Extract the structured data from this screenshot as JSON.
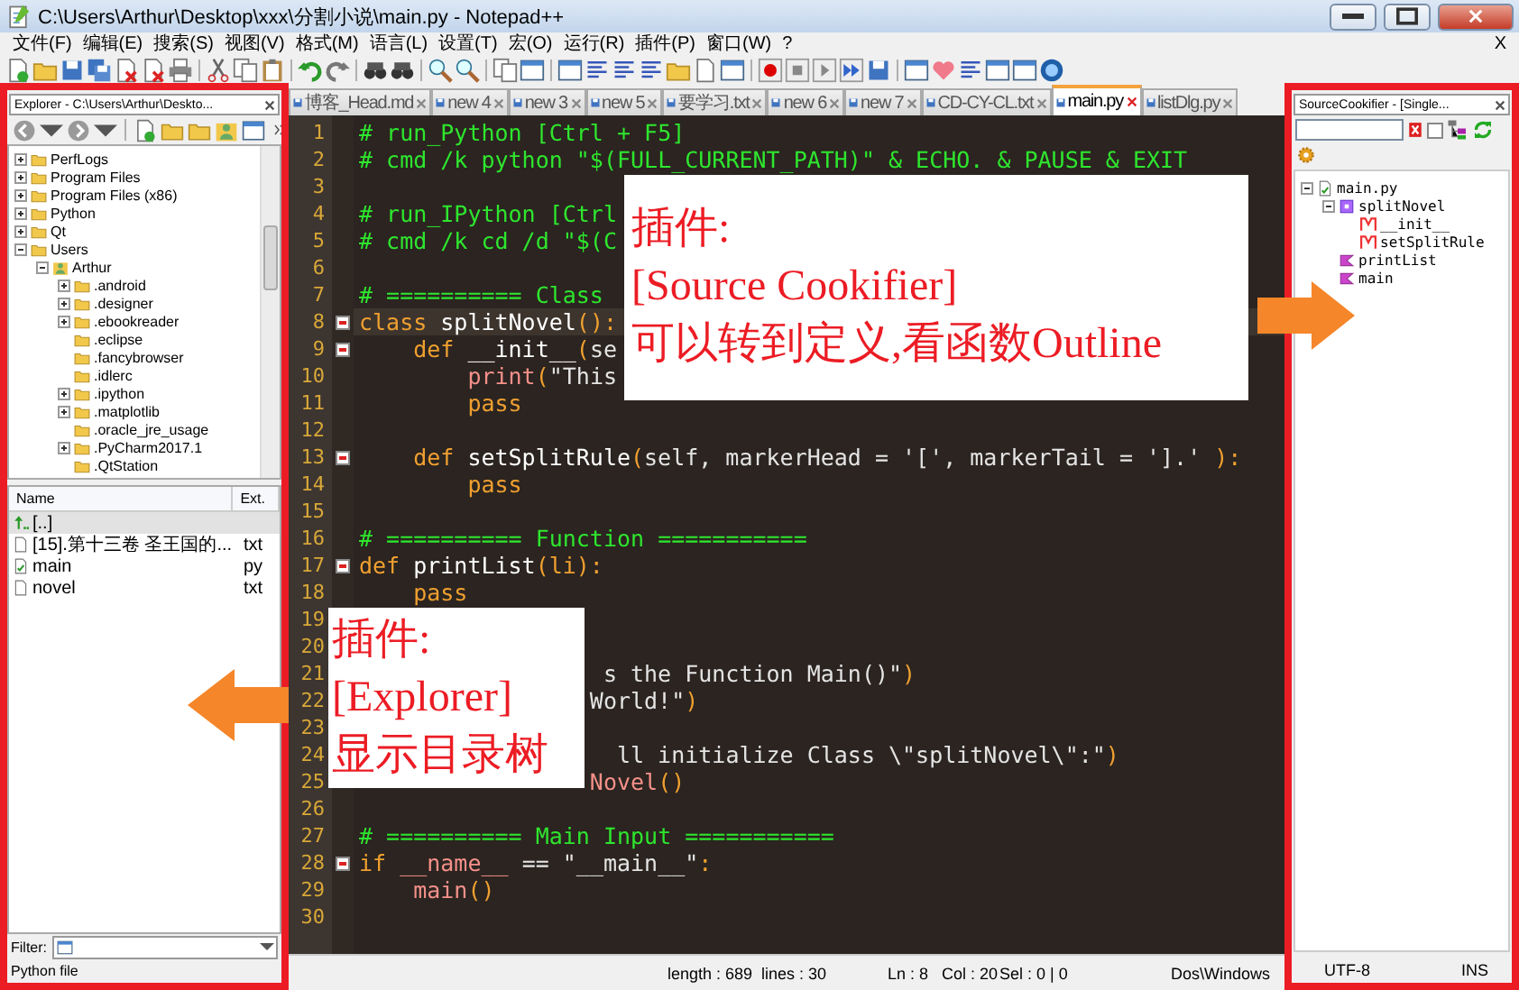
{
  "window": {
    "title": "C:\\Users\\Arthur\\Desktop\\xxx\\分割小说\\main.py - Notepad++"
  },
  "menu": {
    "items": [
      "文件(F)",
      "编辑(E)",
      "搜索(S)",
      "视图(V)",
      "格式(M)",
      "语言(L)",
      "设置(T)",
      "宏(O)",
      "运行(R)",
      "插件(P)",
      "窗口(W)",
      "?"
    ],
    "close": "X"
  },
  "explorer": {
    "title": "Explorer - C:\\Users\\Arthur\\Deskto...",
    "tree": [
      {
        "label": "PerfLogs",
        "kind": "folder",
        "expanded": false
      },
      {
        "label": "Program Files",
        "kind": "folder",
        "expanded": false
      },
      {
        "label": "Program Files (x86)",
        "kind": "folder",
        "expanded": false
      },
      {
        "label": "Python",
        "kind": "folder",
        "expanded": false
      },
      {
        "label": "Qt",
        "kind": "folder",
        "expanded": false
      },
      {
        "label": "Users",
        "kind": "folder",
        "expanded": true,
        "children": [
          {
            "label": "Arthur",
            "kind": "user",
            "expanded": true,
            "children": [
              {
                "label": ".android",
                "kind": "folder",
                "expanded": false
              },
              {
                "label": ".designer",
                "kind": "folder",
                "expanded": false
              },
              {
                "label": ".ebookreader",
                "kind": "folder",
                "expanded": false
              },
              {
                "label": ".eclipse",
                "kind": "folder"
              },
              {
                "label": ".fancybrowser",
                "kind": "folder"
              },
              {
                "label": ".idlerc",
                "kind": "folder"
              },
              {
                "label": ".ipython",
                "kind": "folder",
                "expanded": false
              },
              {
                "label": ".matplotlib",
                "kind": "folder",
                "expanded": false
              },
              {
                "label": ".oracle_jre_usage",
                "kind": "folder"
              },
              {
                "label": ".PyCharm2017.1",
                "kind": "folder",
                "expanded": false
              },
              {
                "label": ".QtStation",
                "kind": "folder"
              }
            ]
          }
        ]
      }
    ],
    "files": {
      "columns": [
        "Name",
        "Ext."
      ],
      "rows": [
        {
          "name": "[..]",
          "kind": "parent",
          "selected": true
        },
        {
          "name": "[15].第十三卷 圣王国的...",
          "ext": "txt",
          "kind": "text",
          "selected": false
        },
        {
          "name": "main",
          "ext": "py",
          "kind": "script",
          "selected": false
        },
        {
          "name": "novel",
          "ext": "txt",
          "kind": "text",
          "selected": false
        }
      ]
    },
    "filter_label": "Filter:",
    "status": "Python file"
  },
  "tabs": [
    {
      "label": "博客_Head.md",
      "selected": false
    },
    {
      "label": "new 4",
      "selected": false
    },
    {
      "label": "new 3",
      "selected": false
    },
    {
      "label": "new 5",
      "selected": false
    },
    {
      "label": "要学习.txt",
      "selected": false
    },
    {
      "label": "new 6",
      "selected": false
    },
    {
      "label": "new 7",
      "selected": false
    },
    {
      "label": "CD-CY-CL.txt",
      "selected": false
    },
    {
      "label": "main.py",
      "selected": true
    },
    {
      "label": "listDlg.py",
      "selected": false
    }
  ],
  "code": {
    "lines": [
      {
        "number": "1",
        "fold": false,
        "current": false,
        "tokens": [
          {
            "kind": "comment",
            "text": "# run_Python [Ctrl + F5]"
          }
        ]
      },
      {
        "number": "2",
        "fold": false,
        "current": false,
        "tokens": [
          {
            "kind": "comment",
            "text": "# cmd /k python \"$(FULL_CURRENT_PATH)\" & ECHO. & PAUSE & EXIT"
          }
        ]
      },
      {
        "number": "3",
        "fold": false,
        "current": false
      },
      {
        "number": "4",
        "fold": false,
        "current": false,
        "tokens": [
          {
            "kind": "comment",
            "text": "# run_IPython [Ctrl"
          }
        ]
      },
      {
        "number": "5",
        "fold": false,
        "current": false,
        "tokens": [
          {
            "kind": "comment",
            "text": "# cmd /k cd /d \"$(C"
          }
        ]
      },
      {
        "number": "6",
        "fold": false,
        "current": false
      },
      {
        "number": "7",
        "fold": false,
        "current": false,
        "tokens": [
          {
            "kind": "comment",
            "text": "# ========== Class"
          }
        ]
      },
      {
        "number": "8",
        "fold": true,
        "current": true,
        "tokens": [
          {
            "kind": "keyword",
            "text": "class"
          },
          {
            "kind": "name",
            "text": " splitNovel"
          },
          {
            "kind": "paren",
            "text": "():"
          }
        ]
      },
      {
        "number": "9",
        "fold": true,
        "current": false,
        "tokens": [
          {
            "kind": "keyword",
            "text": "    def"
          },
          {
            "kind": "name",
            "text": " __init__"
          },
          {
            "kind": "paren",
            "text": "("
          },
          {
            "kind": "plain",
            "text": "se"
          }
        ]
      },
      {
        "number": "10",
        "fold": false,
        "current": false,
        "tokens": [
          {
            "kind": "builtin",
            "text": "        print"
          },
          {
            "kind": "paren",
            "text": "("
          },
          {
            "kind": "string",
            "text": "\"This"
          }
        ]
      },
      {
        "number": "11",
        "fold": false,
        "current": false,
        "tokens": [
          {
            "kind": "keyword",
            "text": "        pass"
          }
        ]
      },
      {
        "number": "12",
        "fold": false,
        "current": false
      },
      {
        "number": "13",
        "fold": true,
        "current": false,
        "tokens": [
          {
            "kind": "keyword",
            "text": "    def"
          },
          {
            "kind": "name",
            "text": " setSplitRule"
          },
          {
            "kind": "paren",
            "text": "("
          },
          {
            "kind": "plain",
            "text": "self, markerHead = "
          },
          {
            "kind": "string",
            "text": "'['"
          },
          {
            "kind": "plain",
            "text": ", markerTail = "
          },
          {
            "kind": "string",
            "text": "'].'"
          },
          {
            "kind": "paren",
            "text": " ):"
          }
        ]
      },
      {
        "number": "14",
        "fold": false,
        "current": false,
        "tokens": [
          {
            "kind": "keyword",
            "text": "        pass"
          }
        ]
      },
      {
        "number": "15",
        "fold": false,
        "current": false
      },
      {
        "number": "16",
        "fold": false,
        "current": false,
        "tokens": [
          {
            "kind": "comment",
            "text": "# ========== Function ==========="
          }
        ]
      },
      {
        "number": "17",
        "fold": true,
        "current": false,
        "tokens": [
          {
            "kind": "keyword",
            "text": "def"
          },
          {
            "kind": "name",
            "text": " printList"
          },
          {
            "kind": "paren",
            "text": "(li):"
          }
        ]
      },
      {
        "number": "18",
        "fold": false,
        "current": false,
        "tokens": [
          {
            "kind": "keyword",
            "text": "    pass"
          }
        ]
      },
      {
        "number": "19",
        "fold": false,
        "current": false
      },
      {
        "number": "20",
        "fold": false,
        "current": false
      },
      {
        "number": "21",
        "fold": false,
        "current": false,
        "tokens": [
          {
            "kind": "string",
            "text": "                  s the Function Main()\""
          },
          {
            "kind": "paren",
            "text": ")"
          }
        ]
      },
      {
        "number": "22",
        "fold": false,
        "current": false,
        "tokens": [
          {
            "kind": "string",
            "text": "                 World!\""
          },
          {
            "kind": "paren",
            "text": ")"
          }
        ]
      },
      {
        "number": "23",
        "fold": false,
        "current": false
      },
      {
        "number": "24",
        "fold": false,
        "current": false,
        "tokens": [
          {
            "kind": "string",
            "text": "                   ll initialize Class \\\"splitNovel\\\":\""
          },
          {
            "kind": "paren",
            "text": ")"
          }
        ]
      },
      {
        "number": "25",
        "fold": false,
        "current": false,
        "tokens": [
          {
            "kind": "builtin",
            "text": "                 Novel"
          },
          {
            "kind": "paren",
            "text": "()"
          }
        ]
      },
      {
        "number": "26",
        "fold": false,
        "current": false
      },
      {
        "number": "27",
        "fold": false,
        "current": false,
        "tokens": [
          {
            "kind": "comment",
            "text": "# ========== Main Input ==========="
          }
        ]
      },
      {
        "number": "28",
        "fold": true,
        "current": false,
        "tokens": [
          {
            "kind": "keyword",
            "text": "if"
          },
          {
            "kind": "builtin",
            "text": " __name__"
          },
          {
            "kind": "plain",
            "text": " == "
          },
          {
            "kind": "string",
            "text": "\"__main__\""
          },
          {
            "kind": "paren",
            "text": ":"
          }
        ]
      },
      {
        "number": "29",
        "fold": false,
        "current": false,
        "tokens": [
          {
            "kind": "builtin",
            "text": "    main"
          },
          {
            "kind": "paren",
            "text": "()"
          }
        ]
      },
      {
        "number": "30",
        "fold": false,
        "current": false
      }
    ]
  },
  "status_bar": {
    "cells": [
      "length : 689",
      "lines : 30",
      "Ln : 8",
      "Col : 20",
      "Sel : 0 | 0",
      "Dos\\Windows"
    ]
  },
  "source_cookifier": {
    "title": "SourceCookifier - [Single...",
    "checkbox": {
      "checked": false
    },
    "tree": [
      {
        "label": "main.py",
        "kind": "file",
        "expanded": true,
        "children": [
          {
            "label": "splitNovel",
            "kind": "class",
            "expanded": true,
            "children": [
              {
                "label": "__init__",
                "kind": "method"
              },
              {
                "label": "setSplitRule",
                "kind": "method"
              }
            ]
          },
          {
            "label": "printList",
            "kind": "function"
          },
          {
            "label": "main",
            "kind": "function"
          }
        ]
      }
    ],
    "status_cells": [
      "UTF-8",
      "INS"
    ]
  },
  "annotations": [
    {
      "lines": [
        "插件:",
        "[Source Cookifier]",
        "可以转到定义,看函数Outline"
      ]
    },
    {
      "lines": [
        "插件:",
        "[Explorer]",
        "显示目录树"
      ]
    }
  ]
}
